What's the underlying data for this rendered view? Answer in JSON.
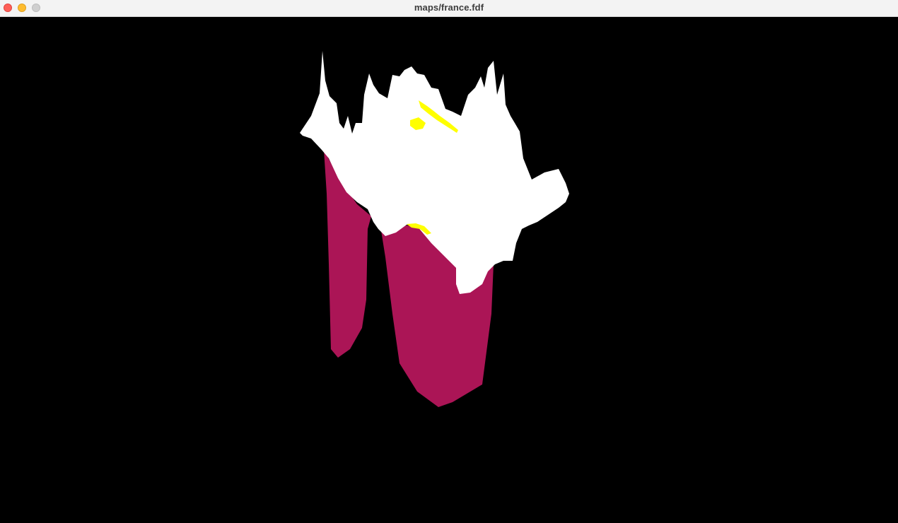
{
  "window": {
    "title": "maps/france.fdf"
  },
  "colors": {
    "background": "#000000",
    "wire_low": "#ab1556",
    "wire_mid": "#ffff00",
    "wire_high": "#ffffff"
  },
  "icons": {
    "close": "close-icon",
    "minimize": "minimize-icon",
    "zoom": "zoom-icon"
  }
}
